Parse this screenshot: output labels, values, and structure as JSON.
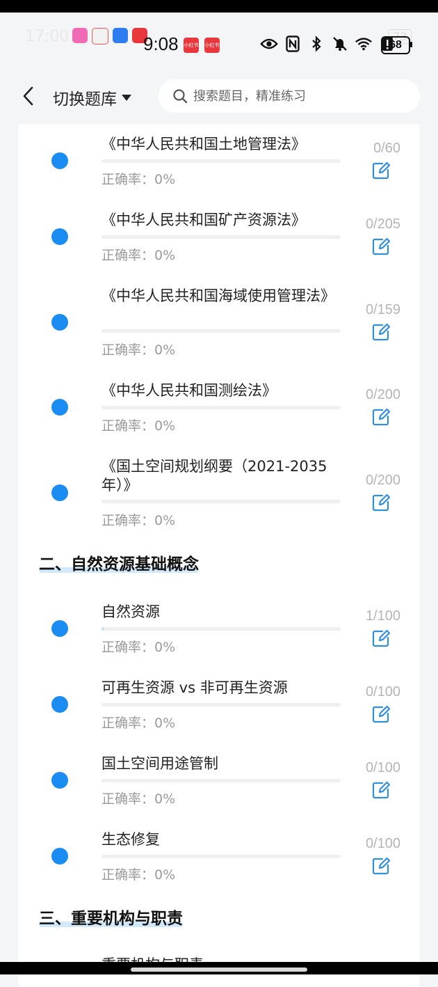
{
  "ghost_status": {
    "time": "17:00",
    "battery": "73"
  },
  "status_bar": {
    "time": "9:08",
    "app_badges": [
      "小红书",
      "小红书"
    ],
    "battery_level": "68"
  },
  "header": {
    "switch_label": "切换题库",
    "search_placeholder": "搜索题目，精准练习"
  },
  "sections": [
    {
      "title": "",
      "items": [
        {
          "title": "《中华人民共和国土地管理法》",
          "progress": "0/60",
          "accuracy": "正确率：0%",
          "fraction": 0
        },
        {
          "title": "《中华人民共和国矿产资源法》",
          "progress": "0/205",
          "accuracy": "正确率：0%",
          "fraction": 0
        },
        {
          "title": "《中华人民共和国海域使用管理法》",
          "progress": "0/159",
          "accuracy": "正确率：0%",
          "fraction": 0
        },
        {
          "title": "《中华人民共和国测绘法》",
          "progress": "0/200",
          "accuracy": "正确率：0%",
          "fraction": 0
        },
        {
          "title": "《国土空间规划纲要（2021-2035年）》",
          "progress": "0/200",
          "accuracy": "正确率：0%",
          "fraction": 0
        }
      ]
    },
    {
      "title": "二、自然资源基础概念",
      "items": [
        {
          "title": "自然资源",
          "progress": "1/100",
          "accuracy": "正确率：0%",
          "fraction": 0.01
        },
        {
          "title": "可再生资源 vs 非可再生资源",
          "progress": "0/100",
          "accuracy": "正确率：0%",
          "fraction": 0
        },
        {
          "title": "国土空间用途管制",
          "progress": "0/100",
          "accuracy": "正确率：0%",
          "fraction": 0
        },
        {
          "title": "生态修复",
          "progress": "0/100",
          "accuracy": "正确率：0%",
          "fraction": 0
        }
      ]
    },
    {
      "title": "三、重要机构与职责",
      "items": [
        {
          "title": "重要机构与职责",
          "progress": "",
          "accuracy": "",
          "fraction": 0
        }
      ]
    }
  ],
  "colors": {
    "accent": "#1a8cf2",
    "progress_fill": "#bfe0ff",
    "section_highlight": "#d2e8fb"
  }
}
